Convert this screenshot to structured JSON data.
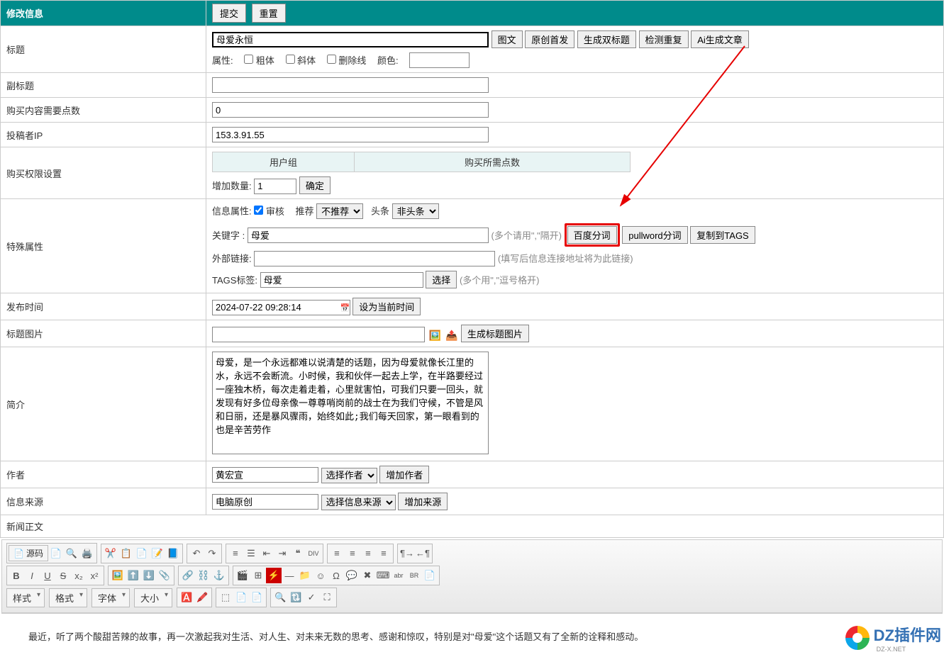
{
  "header": {
    "title": "修改信息",
    "submit": "提交",
    "reset": "重置"
  },
  "rows": {
    "title": {
      "label": "标题",
      "value": "母爱永恒",
      "btn_imgtext": "图文",
      "btn_original": "原创首发",
      "btn_dualtitle": "生成双标题",
      "btn_detect": "检测重复",
      "btn_ai": "Ai生成文章",
      "attr_label": "属性:",
      "bold": "粗体",
      "italic": "斜体",
      "strike": "删除线",
      "color_label": "颜色:"
    },
    "subtitle": {
      "label": "副标题",
      "value": ""
    },
    "points": {
      "label": "购买内容需要点数",
      "value": "0"
    },
    "ip": {
      "label": "投稿者IP",
      "value": "153.3.91.55"
    },
    "perm": {
      "label": "购买权限设置",
      "th1": "用户组",
      "th2": "购买所需点数",
      "qty_label": "增加数量:",
      "qty_val": "1",
      "confirm": "确定"
    },
    "special": {
      "label": "特殊属性",
      "attr_label": "信息属性:",
      "audit": "审核",
      "rec_label": "推荐",
      "rec_val": "不推荐",
      "head_label": "头条",
      "head_val": "非头条",
      "kw_label": "关键字   :",
      "kw_val": "母爱",
      "kw_hint": "(多个请用\",\"隔开)",
      "btn_baidu": "百度分词",
      "btn_pull": "pullword分词",
      "btn_copy": "复制到TAGS",
      "link_label": "外部链接:",
      "link_val": "",
      "link_hint": "(填写后信息连接地址将为此链接)",
      "tags_label": "TAGS标签:",
      "tags_val": "母爱",
      "btn_select": "选择",
      "tags_hint": "(多个用\",\"逗号格开)"
    },
    "pubtime": {
      "label": "发布时间",
      "value": "2024-07-22 09:28:14",
      "btn_now": "设为当前时间"
    },
    "titleimg": {
      "label": "标题图片",
      "value": "",
      "btn_gen": "生成标题图片"
    },
    "summary": {
      "label": "简介",
      "value": "母爱，是一个永远都难以说清楚的话题，因为母爱就像长江里的水，永远不会断流。小时候，我和伙伴一起去上学，在半路要经过一座独木桥，每次走着走着，心里就害怕，可我们只要一回头，就发现有好多位母亲像一尊尊哨岗前的战士在为我们守候，不管是风和日丽，还是暴风骤雨，始终如此;我们每天回家，第一眼看到的也是辛苦劳作"
    },
    "author": {
      "label": "作者",
      "value": "黄宏宣",
      "sel": "选择作者",
      "btn_add": "增加作者"
    },
    "source": {
      "label": "信息来源",
      "value": "电脑原创",
      "sel": "选择信息来源",
      "btn_add": "增加来源"
    },
    "content": {
      "label": "新闻正文"
    }
  },
  "editor": {
    "source": "源码",
    "style": "样式",
    "format": "格式",
    "font": "字体",
    "size": "大小"
  },
  "footer": "最近，听了两个酸甜苦辣的故事，再一次激起我对生活、对人生、对未来无数的思考、感谢和惊叹，特别是对\"母爱\"这个话题又有了全新的诠释和感动。",
  "watermark": {
    "text": "DZ插件网",
    "sub": "DZ-X.NET"
  }
}
